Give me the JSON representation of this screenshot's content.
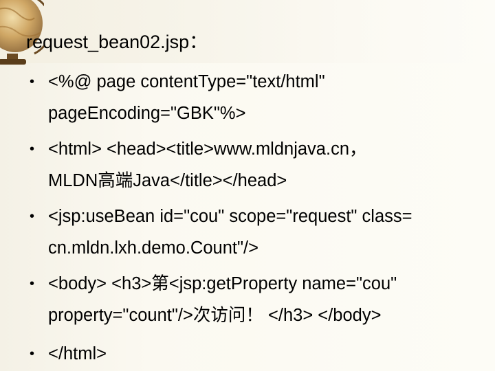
{
  "slide": {
    "title": "request_bean02.jsp：",
    "bullets": [
      {
        "line1": "<%@ page contentType=\"text/html\"",
        "line2": "pageEncoding=\"GBK\"%>"
      },
      {
        "line1": "<html> <head><title>www.mldnjava.cn，",
        "line2": "MLDN高端Java</title></head>"
      },
      {
        "line1": "<jsp:useBean id=\"cou\" scope=\"request\" class=",
        "line2": "cn.mldn.lxh.demo.Count\"/>"
      },
      {
        "line1": "<body> <h3>第<jsp:getProperty name=\"cou\"",
        "line2": "property=\"count\"/>次访问！ </h3> </body>"
      },
      {
        "line1": "</html>",
        "line2": ""
      }
    ],
    "bullet_symbol": "•",
    "decoration_icon": "globe-icon",
    "colors": {
      "text": "#000000",
      "background": "#fbf9f1"
    }
  }
}
